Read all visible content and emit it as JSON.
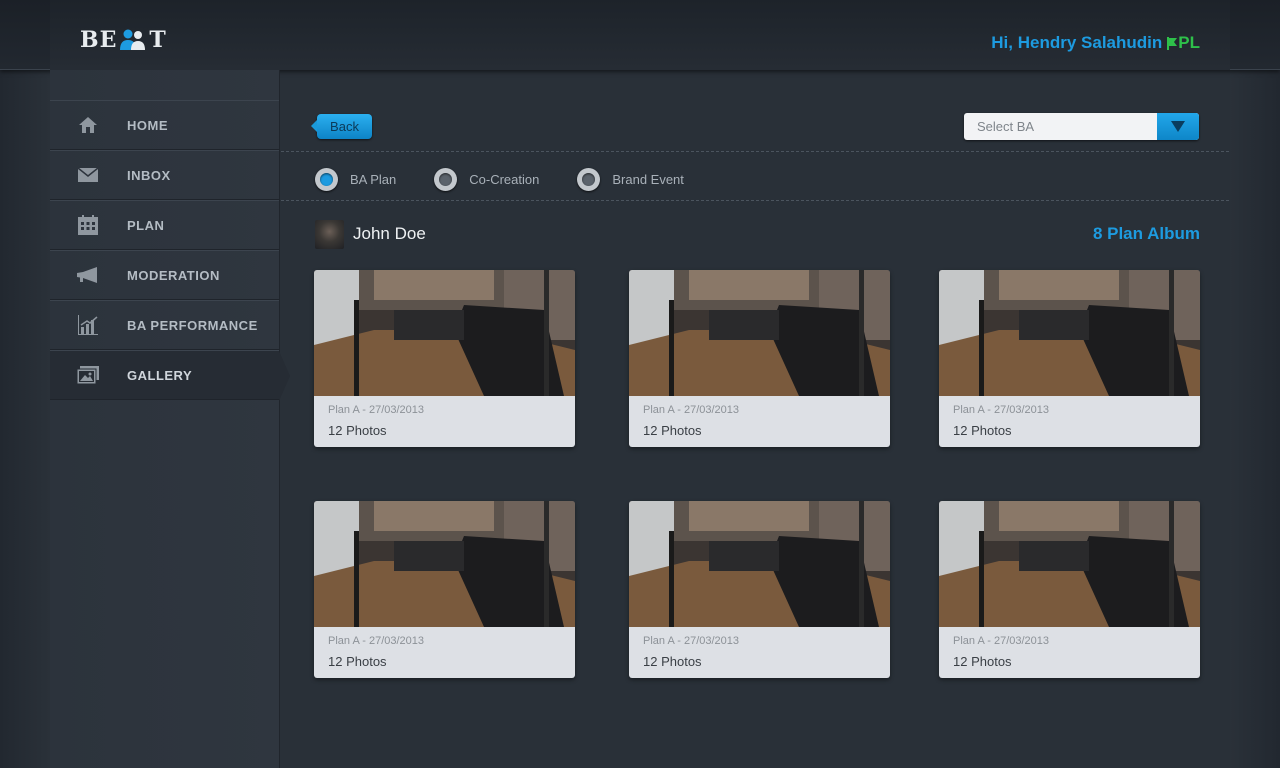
{
  "app": {
    "logo_left": "BE",
    "logo_right": "T"
  },
  "header": {
    "greeting": "Hi, Hendry Salahudin",
    "badge": "PL"
  },
  "sidebar": {
    "items": [
      {
        "label": "HOME",
        "icon": "home-icon"
      },
      {
        "label": "INBOX",
        "icon": "envelope-icon"
      },
      {
        "label": "PLAN",
        "icon": "calendar-icon"
      },
      {
        "label": "MODERATION",
        "icon": "megaphone-icon"
      },
      {
        "label": "BA PERFORMANCE",
        "icon": "bar-chart-icon"
      },
      {
        "label": "GALLERY",
        "icon": "gallery-icon",
        "active": true
      }
    ]
  },
  "toolbar": {
    "back_label": "Back",
    "select_placeholder": "Select BA"
  },
  "filters": {
    "options": [
      {
        "label": "BA Plan",
        "checked": true
      },
      {
        "label": "Co-Creation",
        "checked": false
      },
      {
        "label": "Brand Event",
        "checked": false
      }
    ]
  },
  "user": {
    "name": "John Doe",
    "album_count": "8 Plan Album"
  },
  "albums": [
    {
      "title": "Plan A - 27/03/2013",
      "count": "12 Photos"
    },
    {
      "title": "Plan A - 27/03/2013",
      "count": "12 Photos"
    },
    {
      "title": "Plan A - 27/03/2013",
      "count": "12 Photos"
    },
    {
      "title": "Plan A - 27/03/2013",
      "count": "12 Photos"
    },
    {
      "title": "Plan A - 27/03/2013",
      "count": "12 Photos"
    },
    {
      "title": "Plan A - 27/03/2013",
      "count": "12 Photos"
    }
  ],
  "colors": {
    "accent": "#1d9be0",
    "flag": "#2ec04a",
    "background": "#293038"
  }
}
